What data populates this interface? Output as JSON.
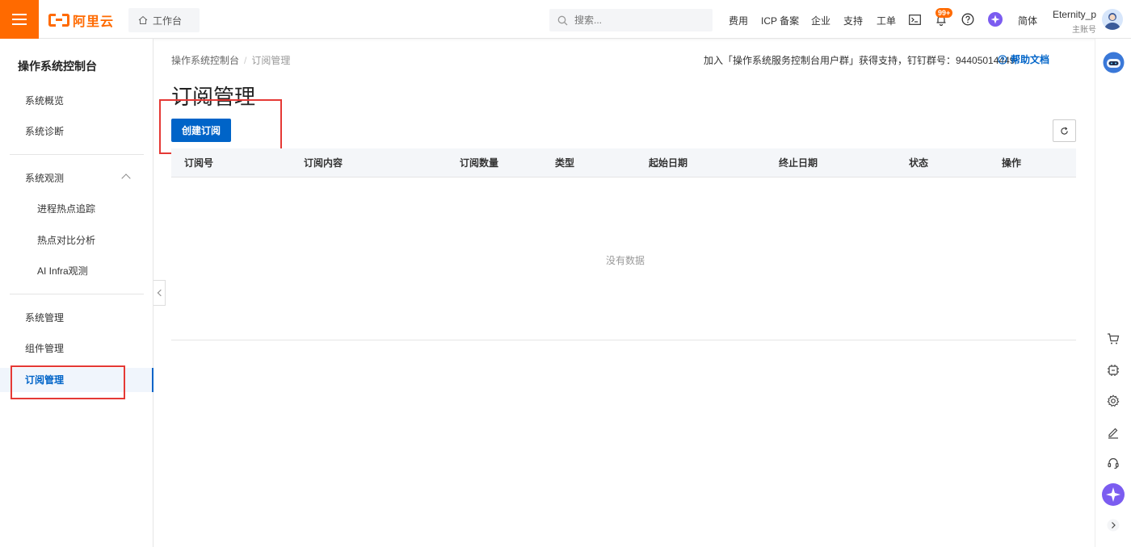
{
  "header": {
    "logo_text": "阿里云",
    "workbench_label": "工作台",
    "search_placeholder": "搜索...",
    "nav": [
      "费用",
      "ICP 备案",
      "企业",
      "支持",
      "工单"
    ],
    "notification_badge": "99+",
    "language_label": "简体",
    "user_name": "Eternity_p",
    "user_role": "主账号",
    "accent_color": "#ff6a00"
  },
  "sidebar": {
    "title": "操作系统控制台",
    "items": [
      {
        "label": "系统概览"
      },
      {
        "label": "系统诊断"
      },
      {
        "label": "系统观测"
      },
      {
        "label": "进程热点追踪"
      },
      {
        "label": "热点对比分析"
      },
      {
        "label": "AI Infra观测"
      },
      {
        "label": "系统管理"
      },
      {
        "label": "组件管理"
      },
      {
        "label": "订阅管理",
        "active": true
      }
    ]
  },
  "breadcrumb": {
    "root": "操作系统控制台",
    "sep": "/",
    "current": "订阅管理"
  },
  "notice": "加入「操作系统服务控制台用户群」获得支持，钉钉群号：94405014449",
  "help_label": "帮助文档",
  "main": {
    "title": "订阅管理",
    "create_button": "创建订阅",
    "table": {
      "columns": [
        "订阅号",
        "订阅内容",
        "订阅数量",
        "类型",
        "起始日期",
        "终止日期",
        "状态",
        "操作"
      ],
      "rows": [],
      "empty_text": "没有数据"
    }
  },
  "colors": {
    "primary": "#0064c8",
    "highlight": "#e53935"
  }
}
